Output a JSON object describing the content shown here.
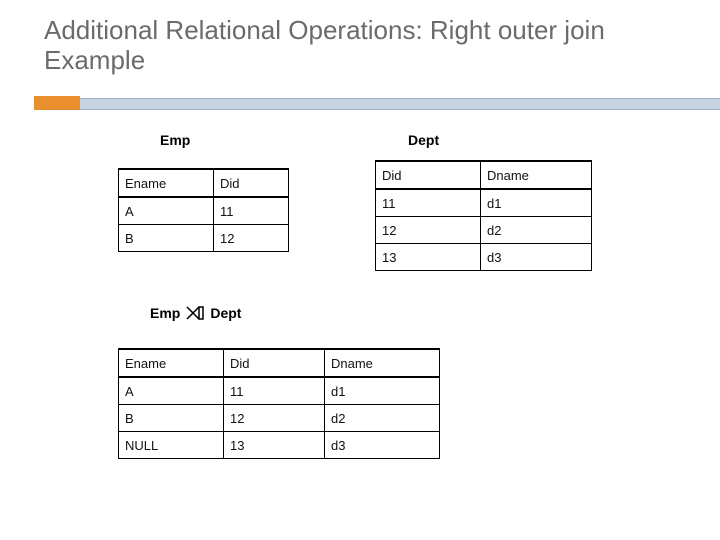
{
  "title": "Additional Relational Operations: Right outer join Example",
  "labels": {
    "emp": "Emp",
    "dept": "Dept",
    "joinLeft": "Emp",
    "joinRight": "Dept"
  },
  "emp": {
    "headers": [
      "Ename",
      "Did"
    ],
    "rows": [
      [
        "A",
        "11"
      ],
      [
        "B",
        "12"
      ]
    ]
  },
  "dept": {
    "headers": [
      "Did",
      "Dname"
    ],
    "rows": [
      [
        "11",
        "d1"
      ],
      [
        "12",
        "d2"
      ],
      [
        "13",
        "d3"
      ]
    ]
  },
  "result": {
    "headers": [
      "Ename",
      "Did",
      "Dname"
    ],
    "rows": [
      [
        "A",
        "11",
        "d1"
      ],
      [
        "B",
        "12",
        "d2"
      ],
      [
        "NULL",
        "13",
        "d3"
      ]
    ]
  }
}
